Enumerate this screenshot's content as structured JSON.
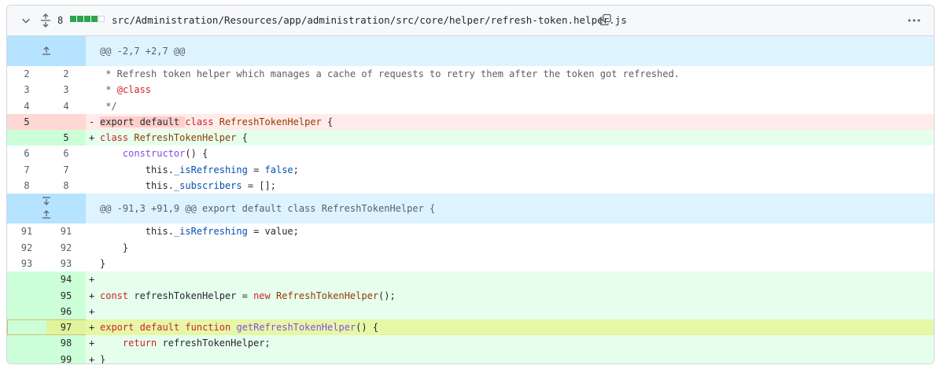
{
  "file": {
    "change_count": "8",
    "path": "src/Administration/Resources/app/administration/src/core/helper/refresh-token.helper.js",
    "diffstat": [
      "add",
      "add",
      "add",
      "add",
      "neutral"
    ]
  },
  "hunk1": {
    "header": "@@ -2,7 +2,7 @@"
  },
  "hunk2": {
    "header": "@@ -91,3 +91,9 @@ export default class RefreshTokenHelper {"
  },
  "lines": [
    {
      "old": "2",
      "new": "2",
      "marker": " ",
      "text": " * Refresh token helper which manages a cache of requests to retry them after the token got refreshed."
    },
    {
      "old": "3",
      "new": "3",
      "marker": " ",
      "text_pre": " * ",
      "text_tag": "@class",
      "text_post": ""
    },
    {
      "old": "4",
      "new": "4",
      "marker": " ",
      "text": " */"
    },
    {
      "old": "5",
      "new": "",
      "marker": "-",
      "del_text": "export default ",
      "text": "class RefreshTokenHelper {"
    },
    {
      "old": "",
      "new": "5",
      "marker": "+",
      "text": "class RefreshTokenHelper {"
    },
    {
      "old": "6",
      "new": "6",
      "marker": " ",
      "text": "    constructor() {"
    },
    {
      "old": "7",
      "new": "7",
      "marker": " ",
      "text": "        this._isRefreshing = false;"
    },
    {
      "old": "8",
      "new": "8",
      "marker": " ",
      "text": "        this._subscribers = [];"
    },
    {
      "old": "91",
      "new": "91",
      "marker": " ",
      "text": "        this._isRefreshing = value;"
    },
    {
      "old": "92",
      "new": "92",
      "marker": " ",
      "text": "    }"
    },
    {
      "old": "93",
      "new": "93",
      "marker": " ",
      "text": "}"
    },
    {
      "old": "",
      "new": "94",
      "marker": "+",
      "text": ""
    },
    {
      "old": "",
      "new": "95",
      "marker": "+",
      "text": "const refreshTokenHelper = new RefreshTokenHelper();"
    },
    {
      "old": "",
      "new": "96",
      "marker": "+",
      "text": ""
    },
    {
      "old": "",
      "new": "97",
      "marker": "+",
      "text": "export default function getRefreshTokenHelper() {"
    },
    {
      "old": "",
      "new": "98",
      "marker": "+",
      "text": "    return refreshTokenHelper;"
    },
    {
      "old": "",
      "new": "99",
      "marker": "+",
      "text": "}"
    }
  ],
  "tokens": {
    "export": "export",
    "default": "default",
    "class": "class",
    "const": "const",
    "new": "new",
    "function": "function",
    "return": "return",
    "false": "false",
    "constructor": "constructor",
    "RefreshTokenHelper": "RefreshTokenHelper",
    "getRefreshTokenHelper": "getRefreshTokenHelper",
    "isRefreshing": "_isRefreshing",
    "subscribers": "_subscribers",
    "this": "this."
  }
}
